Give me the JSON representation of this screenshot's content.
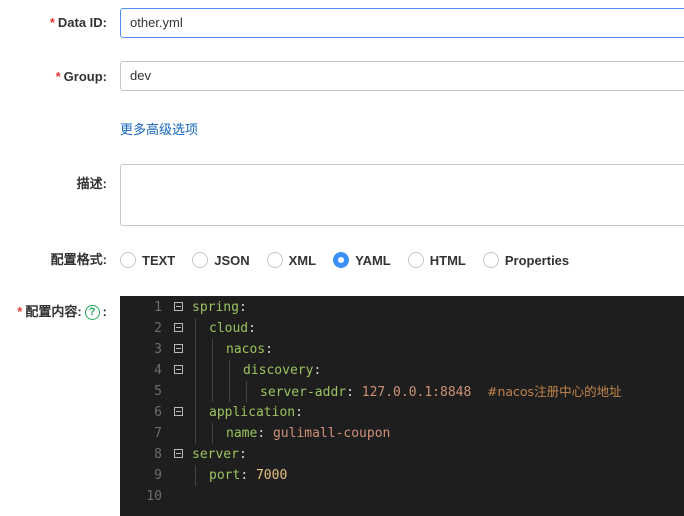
{
  "form": {
    "required_mark": "*",
    "data_id": {
      "label": "Data ID:",
      "value": "other.yml"
    },
    "group": {
      "label": "Group:",
      "value": "dev"
    },
    "advanced_link": "更多高级选项",
    "description": {
      "label": "描述:",
      "value": ""
    },
    "format": {
      "label": "配置格式:",
      "selected": "YAML",
      "options": [
        "TEXT",
        "JSON",
        "XML",
        "YAML",
        "HTML",
        "Properties"
      ]
    },
    "content": {
      "label_main": "配置内容:",
      "help_icon": "?",
      "label_suffix": ":"
    }
  },
  "editor": {
    "line_numbers": [
      "1",
      "2",
      "3",
      "4",
      "5",
      "6",
      "7",
      "8",
      "9",
      "10"
    ],
    "lines": [
      {
        "key": "spring",
        "colon": ":"
      },
      {
        "key": "cloud",
        "colon": ":"
      },
      {
        "key": "nacos",
        "colon": ":"
      },
      {
        "key": "discovery",
        "colon": ":"
      },
      {
        "key": "server-addr",
        "colon": ":",
        "value": "127.0.0.1:8848",
        "comment": "#nacos注册中心的地址"
      },
      {
        "key": "application",
        "colon": ":"
      },
      {
        "key": "name",
        "colon": ":",
        "value": "gulimall-coupon"
      },
      {
        "key": "server",
        "colon": ":"
      },
      {
        "key": "port",
        "colon": ":",
        "value": "7000"
      },
      {
        "key": ""
      }
    ]
  },
  "colors": {
    "required": "#e4393c",
    "link": "#1565c0",
    "radio_selected": "#3b8ff6",
    "editor_bg": "#1e1e1e",
    "yaml_key": "#9bc35f",
    "yaml_value": "#ce9178",
    "yaml_number": "#e4c07c",
    "help_icon": "#23a55a"
  }
}
